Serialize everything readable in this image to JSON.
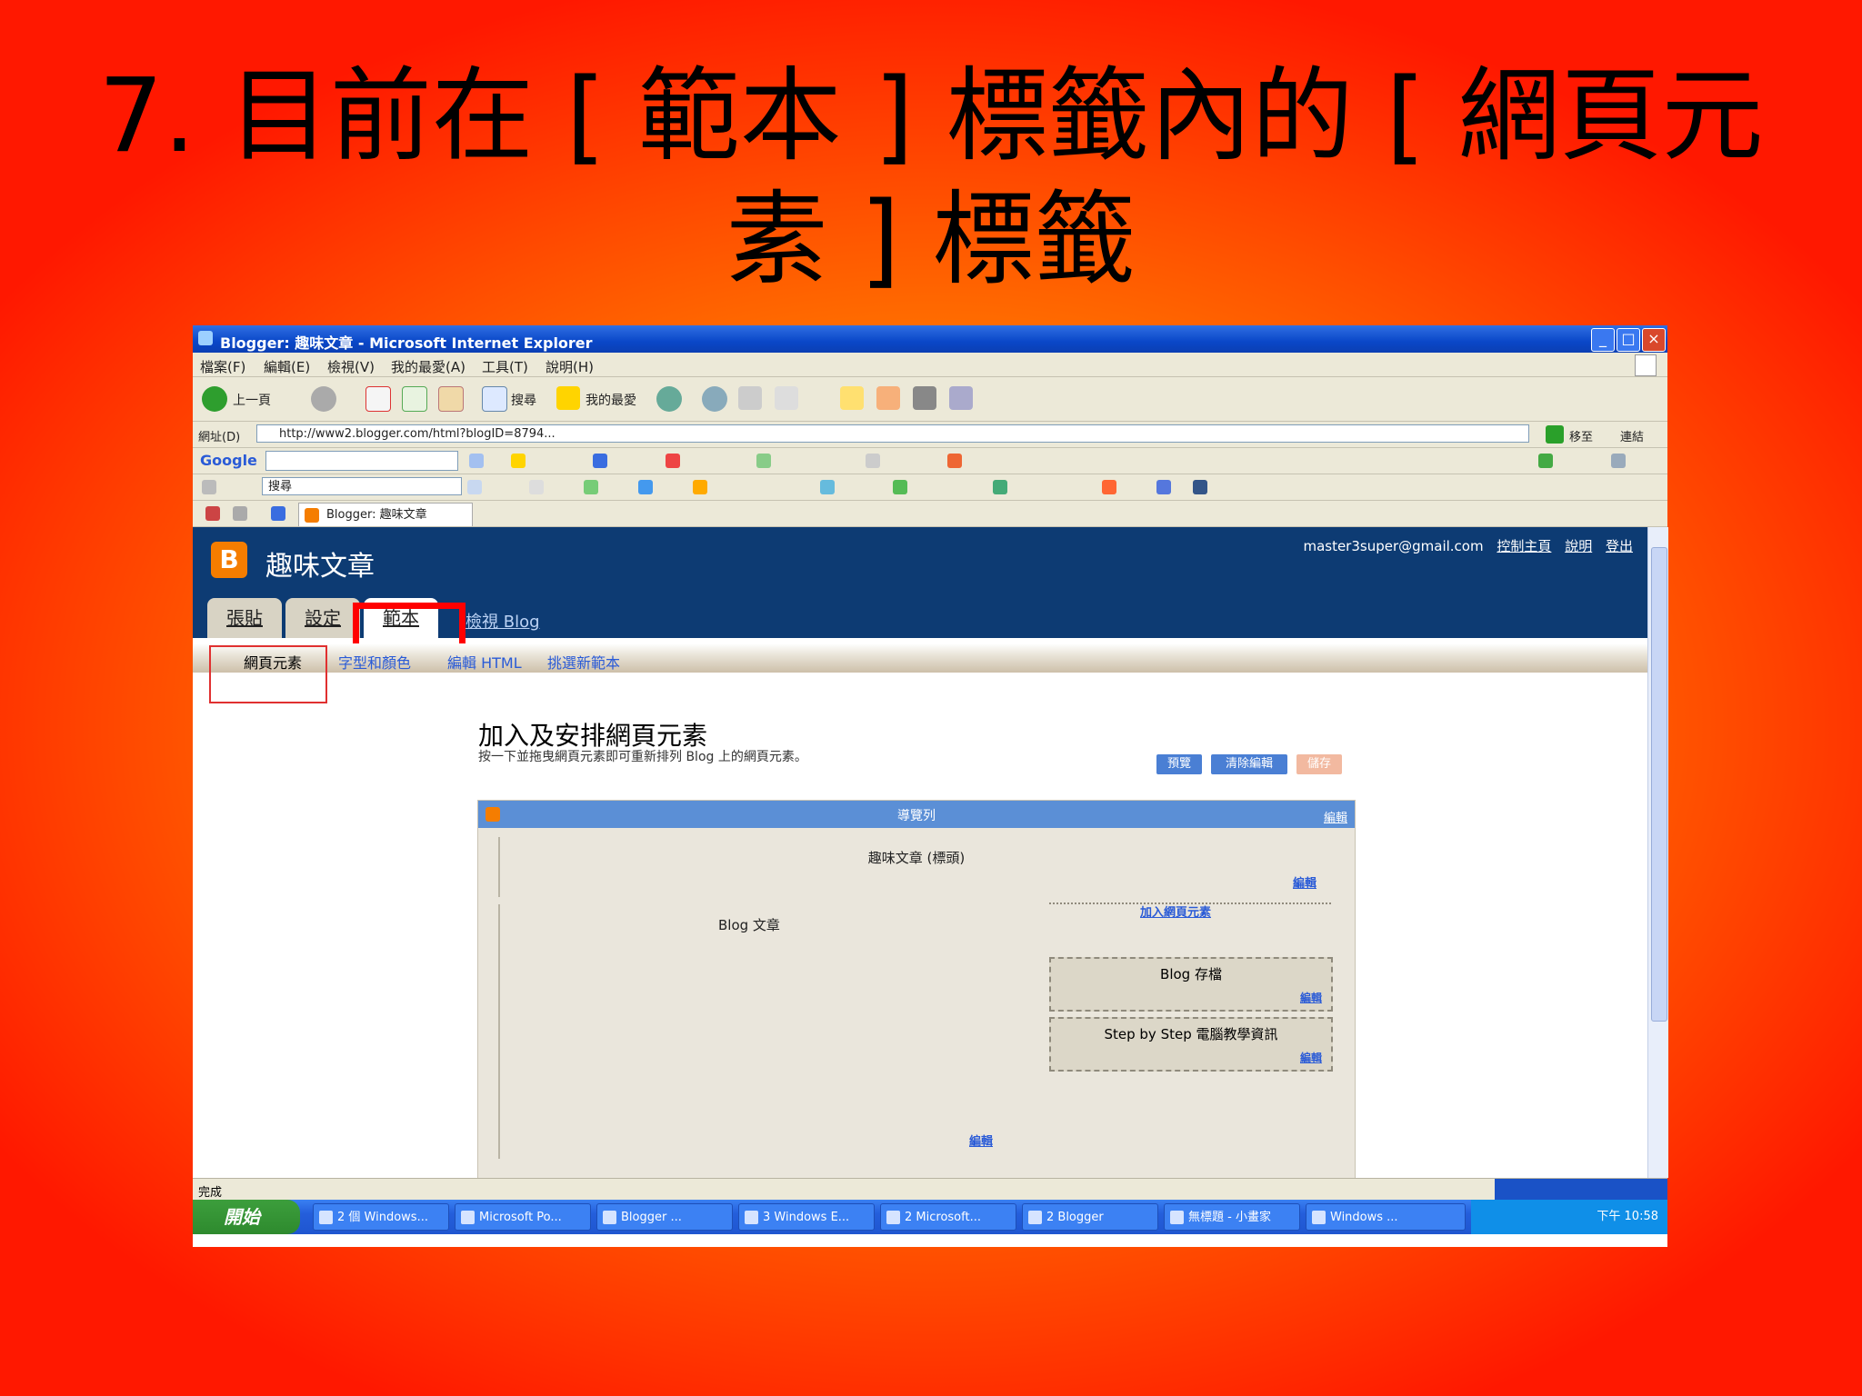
{
  "slide": {
    "title_line1": "7. 目前在 [ 範本 ] 標籤內的 [ 網頁元",
    "title_line2": "素 ] 標籤"
  },
  "window": {
    "title": "Blogger: 趣味文章 - Microsoft Internet Explorer"
  },
  "menubar": [
    "檔案(F)",
    "編輯(E)",
    "檢視(V)",
    "我的最愛(A)",
    "工具(T)",
    "說明(H)"
  ],
  "toolbar": {
    "back_label": "上一頁",
    "search_label": "搜尋",
    "favorites_label": "我的最愛"
  },
  "address": {
    "label": "網址(D)",
    "url": "http://www2.blogger.com/html?blogID=8794...",
    "go_label": "移至",
    "links_label": "連結"
  },
  "google_bar": {
    "logo": "Google"
  },
  "search_bar": {
    "placeholder": "搜尋"
  },
  "browser_tab": {
    "label": "Blogger: 趣味文章"
  },
  "blogger": {
    "blog_name": "趣味文章",
    "user_email": "master3super@gmail.com",
    "links": [
      "控制主頁",
      "說明",
      "登出"
    ],
    "tabs": [
      "張貼",
      "設定",
      "範本"
    ],
    "view_blog": "檢視 Blog",
    "subtabs": [
      "網頁元素",
      "字型和顏色",
      "編輯 HTML",
      "挑選新範本"
    ],
    "page_title": "加入及安排網頁元素",
    "page_desc": "按一下並拖曳網頁元素即可重新排列 Blog 上的網頁元素。",
    "buttons": {
      "preview": "預覽",
      "clear": "清除編輯",
      "save": "儲存"
    },
    "layout": {
      "navbar": "導覽列",
      "navbar_edit": "編輯",
      "header": "趣味文章 (標頭)",
      "header_edit": "編輯",
      "posts": "Blog 文章",
      "add_element": "加入網頁元素",
      "widgets": [
        {
          "title": "Blog 存檔",
          "edit": "編輯"
        },
        {
          "title": "Step by Step 電腦教學資訊",
          "edit": "編輯"
        }
      ],
      "posts_edit": "編輯"
    }
  },
  "statusbar": {
    "text": "完成"
  },
  "taskbar": {
    "start": "開始",
    "items": [
      "2 個 Windows...",
      "Microsoft Po...",
      "Blogger ...",
      "3 Windows E...",
      "2 Microsoft...",
      "2 Blogger",
      "無標題 - 小畫家",
      "Windows ..."
    ],
    "clock": "下午 10:58"
  }
}
